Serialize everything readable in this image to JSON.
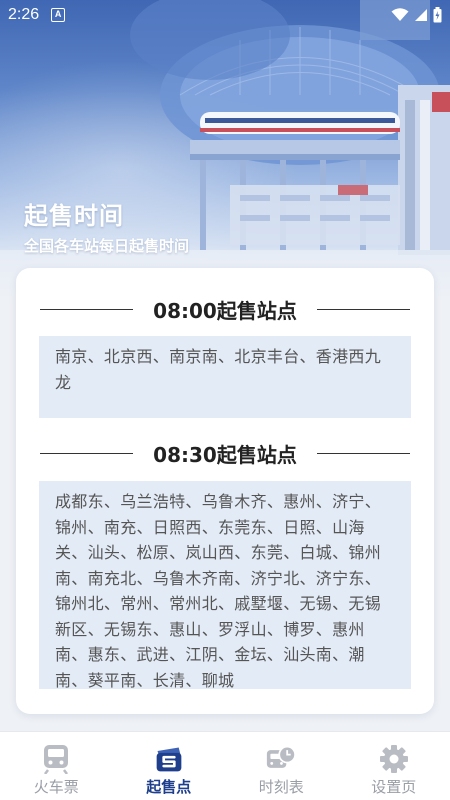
{
  "status_bar": {
    "time": "2:26",
    "notif_badge": "A"
  },
  "header": {
    "title": "起售时间",
    "subtitle": "全国各车站每日起售时间"
  },
  "sections": [
    {
      "heading": "08:00起售站点",
      "stations": "南京、北京西、南京南、北京丰台、香港西九龙"
    },
    {
      "heading": "08:30起售站点",
      "stations": "成都东、乌兰浩特、乌鲁木齐、惠州、济宁、锦州、南充、日照西、东莞东、日照、山海关、汕头、松原、岚山西、东莞、白城、锦州南、南充北、乌鲁木齐南、济宁北、济宁东、锦州北、常州、常州北、戚墅堰、无锡、无锡新区、无锡东、惠山、罗浮山、博罗、惠州南、惠东、武进、江阴、金坛、汕头南、潮南、葵平南、长清、聊城"
    }
  ],
  "nav": {
    "items": [
      {
        "label": "火车票",
        "icon": "train-icon",
        "active": false
      },
      {
        "label": "起售点",
        "icon": "sale-point-icon",
        "active": true
      },
      {
        "label": "时刻表",
        "icon": "schedule-icon",
        "active": false
      },
      {
        "label": "设置页",
        "icon": "gear-icon",
        "active": false
      }
    ]
  },
  "colors": {
    "accent": "#1f3f8c",
    "inactive": "#9a9ea6",
    "box_bg": "#e3ebf6",
    "hero_top": "#3f67b3"
  }
}
